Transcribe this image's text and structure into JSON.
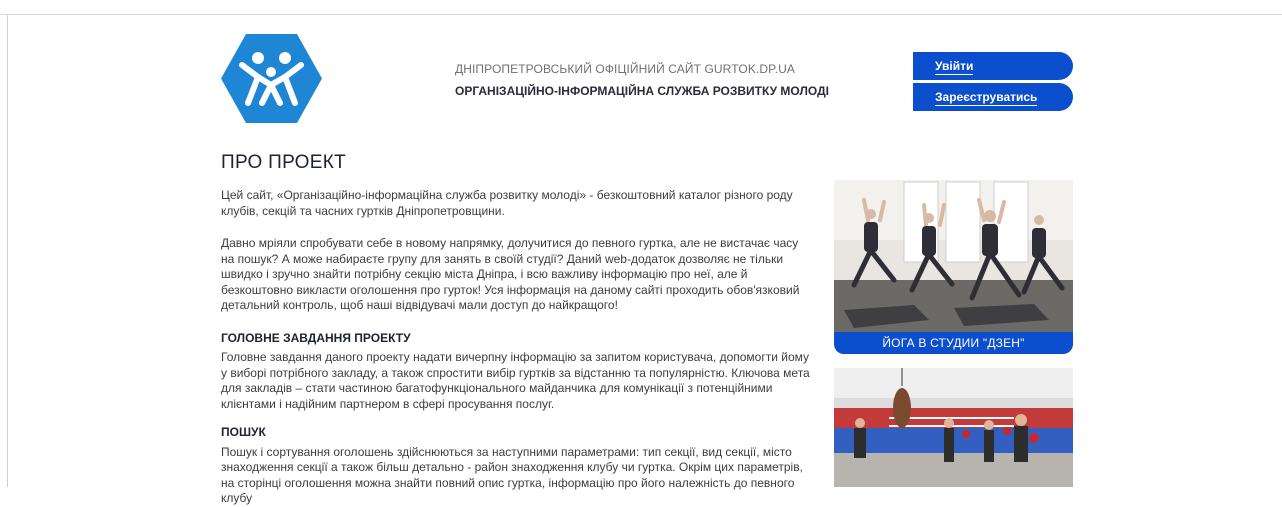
{
  "header": {
    "logo_icon": "people-hexagon-logo",
    "site_line1": "ДНІПРОПЕТРОВСЬКИЙ ОФІЦІЙНИЙ САЙТ GURTOK.DP.UA",
    "site_line2": "ОРГАНІЗАЦІЙНО-ІНФОРМАЦІЙНА СЛУЖБА РОЗВИТКУ МОЛОДІ",
    "login_label": "Увійти",
    "register_label": "Зареєструватись",
    "accent_color": "#0b4fcf",
    "logo_color": "#1f86d6"
  },
  "main": {
    "title": "ПРО ПРОЕКТ",
    "intro": "Цей сайт, «Організаційно-інформаційна служба розвитку молоді» - безкоштовний каталог різного роду клубів, секцій та часних гуртків Дніпропетровщини.",
    "paragraph2": "Давно мріяли спробувати себе в новому напрямку, долучитися до певного гуртка, але не вистачає часу на пошук? А може набираєте групу для занять в своїй студії? Даний web-додаток дозволяє не тільки швидко і зручно знайти потрібну секцію міста Дніпра, і всю важливу інформацію про неї, але й безкоштовно викласти оголошення про гурток! Уся інформація на даному сайті проходить обов'язковий детальний контроль, щоб наші відвідувачі мали доступ до найкращого!",
    "sections": [
      {
        "heading": "ГОЛОВНЕ ЗАВДАННЯ ПРОЕКТУ",
        "text": "Головне завдання даного проекту надати вичерпну інформацію за запитом користувача, допомогти йому у виборі потрібного закладу, а також спростити вибір гуртків за відстанню та популярністю. Ключова мета для закладів – стати частиною багатофункціонального майданчика для комунікації з потенційними клієнтами і надійним партнером в сфері просування послуг."
      },
      {
        "heading": "ПОШУК",
        "text": "Пошук і сортування оголошень здійснюються за наступними параметрами: тип секції, вид секції, місто знаходження секції а також більш детально - район знаходження клубу чи гуртка. Окрім цих параметрів, на сторінці оголошення можна знайти повний опис гуртка, інформацію про його належність до певного клубу"
      }
    ]
  },
  "sidebar": {
    "cards": [
      {
        "caption": "ЙОГА В СТУДИИ \"ДЗЕН\"",
        "image": "yoga-class-photo"
      },
      {
        "caption": "",
        "image": "boxing-gym-photo"
      }
    ]
  }
}
